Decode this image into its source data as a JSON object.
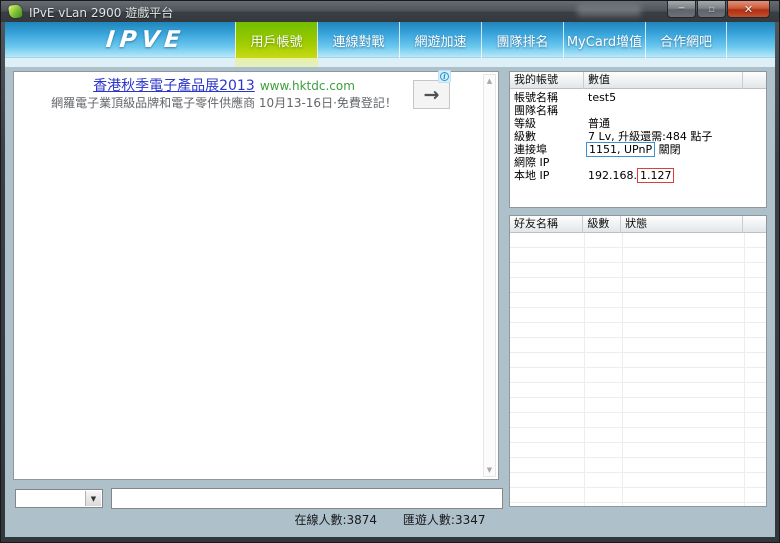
{
  "window": {
    "title": "IPvE vLan 2900 遊戲平台",
    "controls": {
      "minimize": "─",
      "maximize": "▫",
      "close": "✕"
    }
  },
  "nav": {
    "logo": "IPVE",
    "tabs": [
      {
        "label": "用戶帳號",
        "active": true
      },
      {
        "label": "連線對戰",
        "active": false
      },
      {
        "label": "網遊加速",
        "active": false
      },
      {
        "label": "團隊排名",
        "active": false
      },
      {
        "label": "MyCard增值",
        "active": false
      },
      {
        "label": "合作網吧",
        "active": false
      }
    ]
  },
  "ad": {
    "headline": "香港秋季電子產品展2013",
    "site": "www.hktdc.com",
    "description": "網羅電子業頂級品牌和電子零件供應商 10月13-16日·免費登記！",
    "info_icon": "i",
    "arrow_icon": "→"
  },
  "account_panel": {
    "headers": [
      "我的帳號",
      "數值"
    ],
    "rows": [
      {
        "label": "帳號名稱",
        "value": "test5"
      },
      {
        "label": "團隊名稱",
        "value": ""
      },
      {
        "label": "等級",
        "value": "普通"
      },
      {
        "label": "級數",
        "value": "7 Lv, 升級還需:484 點子"
      },
      {
        "label": "連接埠",
        "boxed": "1151, UPnP",
        "rest": "關閉"
      },
      {
        "label": "網際 IP",
        "value": ""
      },
      {
        "label": "本地 IP",
        "prefix": "192.168.",
        "boxed": "1.127"
      }
    ]
  },
  "friends_panel": {
    "headers": [
      "好友名稱",
      "級數",
      "狀態"
    ],
    "rows": []
  },
  "combobox": {
    "value": "",
    "arrow": "▼"
  },
  "chat_input": {
    "value": ""
  },
  "scrollbar": {
    "up": "▲",
    "down": "▼"
  },
  "footer": {
    "online_count": "在線人數:3874",
    "game_count": "匯遊人數:3347"
  },
  "colors": {
    "nav_blue": "#2d9ad0",
    "active_tab_green": "#9ccb00",
    "panel_bg": "#aec0ca",
    "ad_link_blue": "#2b35c9",
    "ad_site_green": "#3c9e3c",
    "highlight_blue_border": "#3f8fd4",
    "highlight_red_border": "#e03c3c",
    "close_button_red": "#c0452c"
  }
}
